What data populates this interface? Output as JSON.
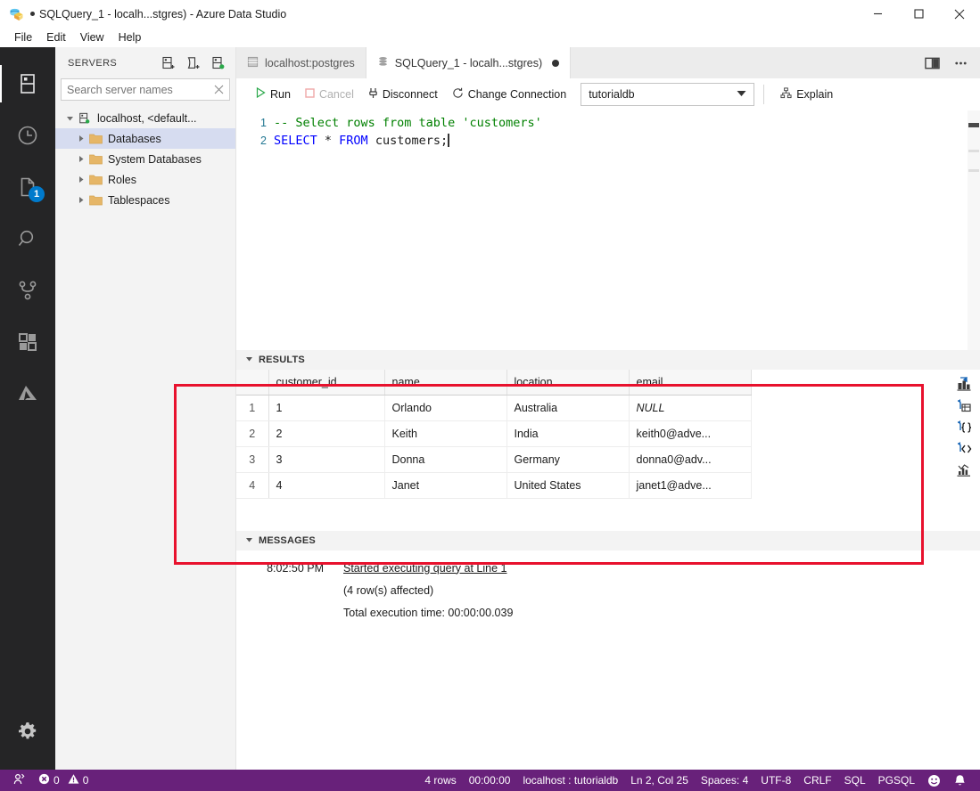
{
  "window": {
    "title": "SQLQuery_1 - localh...stgres) - Azure Data Studio",
    "dirty_marker": "●",
    "minimize_label": "─",
    "maximize_label": "☐",
    "close_label": "✕"
  },
  "menubar": {
    "items": [
      {
        "label": "File"
      },
      {
        "label": "Edit"
      },
      {
        "label": "View"
      },
      {
        "label": "Help"
      }
    ]
  },
  "activitybar": {
    "items": [
      {
        "name": "servers-icon",
        "badge": ""
      },
      {
        "name": "history-icon",
        "badge": ""
      },
      {
        "name": "notebooks-icon",
        "badge": "1"
      },
      {
        "name": "search-icon",
        "badge": ""
      },
      {
        "name": "source-control-icon",
        "badge": ""
      },
      {
        "name": "extensions-icon",
        "badge": ""
      },
      {
        "name": "azure-icon",
        "badge": ""
      }
    ],
    "settings_label": "Manage"
  },
  "sidebar": {
    "title": "SERVERS",
    "actions": [
      {
        "name": "new-connection-icon",
        "tooltip": "New Connection"
      },
      {
        "name": "new-server-group-icon",
        "tooltip": "New Server Group"
      },
      {
        "name": "show-active-connections-icon",
        "tooltip": "Show Active Connections"
      }
    ],
    "search": {
      "placeholder": "Search server names",
      "value": "",
      "clear_label": "✕"
    },
    "tree": [
      {
        "label": "localhost, <default...",
        "icon": "server-icon",
        "level": 0,
        "expanded": true,
        "selected": false
      },
      {
        "label": "Databases",
        "icon": "folder-icon",
        "level": 1,
        "expanded": false,
        "selected": true
      },
      {
        "label": "System Databases",
        "icon": "folder-icon",
        "level": 1,
        "expanded": false,
        "selected": false
      },
      {
        "label": "Roles",
        "icon": "folder-icon",
        "level": 1,
        "expanded": false,
        "selected": false
      },
      {
        "label": "Tablespaces",
        "icon": "folder-icon",
        "level": 1,
        "expanded": false,
        "selected": false
      }
    ]
  },
  "tabs": [
    {
      "label": "localhost:postgres",
      "icon": "server-dashboard-icon",
      "active": false,
      "dirty": false
    },
    {
      "label": "SQLQuery_1 - localh...stgres)",
      "icon": "query-icon",
      "active": true,
      "dirty": true
    }
  ],
  "tab_actions": [
    {
      "name": "split-editor-icon"
    },
    {
      "name": "more-actions-icon",
      "label": "···"
    }
  ],
  "query_toolbar": {
    "run_label": "Run",
    "cancel_label": "Cancel",
    "disconnect_label": "Disconnect",
    "change_connection_label": "Change Connection",
    "database_value": "tutorialdb",
    "explain_label": "Explain"
  },
  "editor": {
    "lines": [
      {
        "number": "1",
        "segments": [
          {
            "text": "-- Select rows from table 'customers'",
            "type": "comment"
          }
        ]
      },
      {
        "number": "2",
        "segments": [
          {
            "text": "SELECT",
            "type": "keyword"
          },
          {
            "text": " * ",
            "type": "plain"
          },
          {
            "text": "FROM",
            "type": "keyword"
          },
          {
            "text": " customers;",
            "type": "plain"
          }
        ]
      }
    ]
  },
  "results": {
    "panel_title": "RESULTS",
    "columns": [
      "customer_id",
      "name",
      "location",
      "email"
    ],
    "rows": [
      {
        "n": "1",
        "cells": [
          "1",
          "Orlando",
          "Australia",
          "NULL"
        ]
      },
      {
        "n": "2",
        "cells": [
          "2",
          "Keith",
          "India",
          "keith0@adve..."
        ]
      },
      {
        "n": "3",
        "cells": [
          "3",
          "Donna",
          "Germany",
          "donna0@adv..."
        ]
      },
      {
        "n": "4",
        "cells": [
          "4",
          "Janet",
          "United States",
          "janet1@adve..."
        ]
      }
    ],
    "actions": [
      {
        "name": "save-as-excel-icon"
      },
      {
        "name": "save-as-csv-icon"
      },
      {
        "name": "save-as-json-icon"
      },
      {
        "name": "save-as-xml-icon"
      },
      {
        "name": "view-as-chart-icon"
      }
    ]
  },
  "messages": {
    "panel_title": "MESSAGES",
    "time": "8:02:50 PM",
    "lines": [
      {
        "text": "Started executing query at Line 1",
        "link": true
      },
      {
        "text": "(4 row(s) affected)",
        "link": false
      },
      {
        "text": "Total execution time: 00:00:00.039",
        "link": false
      }
    ]
  },
  "statusbar": {
    "remote_icon": "remote-icon",
    "errors": "0",
    "warnings": "0",
    "right_items": [
      {
        "label": "4 rows",
        "name": "status-row-count"
      },
      {
        "label": "00:00:00",
        "name": "status-exec-time"
      },
      {
        "label": "localhost : tutorialdb",
        "name": "status-connection"
      },
      {
        "label": "Ln 2, Col 25",
        "name": "status-cursor-position"
      },
      {
        "label": "Spaces: 4",
        "name": "status-indentation"
      },
      {
        "label": "UTF-8",
        "name": "status-encoding"
      },
      {
        "label": "CRLF",
        "name": "status-eol"
      },
      {
        "label": "SQL",
        "name": "status-language-mode"
      },
      {
        "label": "PGSQL",
        "name": "status-provider"
      }
    ],
    "feedback_icon": "smiley-icon",
    "bell_icon": "bell-icon"
  },
  "colors": {
    "accent_purple": "#68217a",
    "highlight_red": "#e8112d",
    "activity_bar": "#252526",
    "sidebar_bg": "#f3f3f3",
    "badge_blue": "#007acc",
    "keyword_blue": "#0000ff",
    "comment_green": "#008000",
    "selected_tree": "#d6dcf0"
  }
}
